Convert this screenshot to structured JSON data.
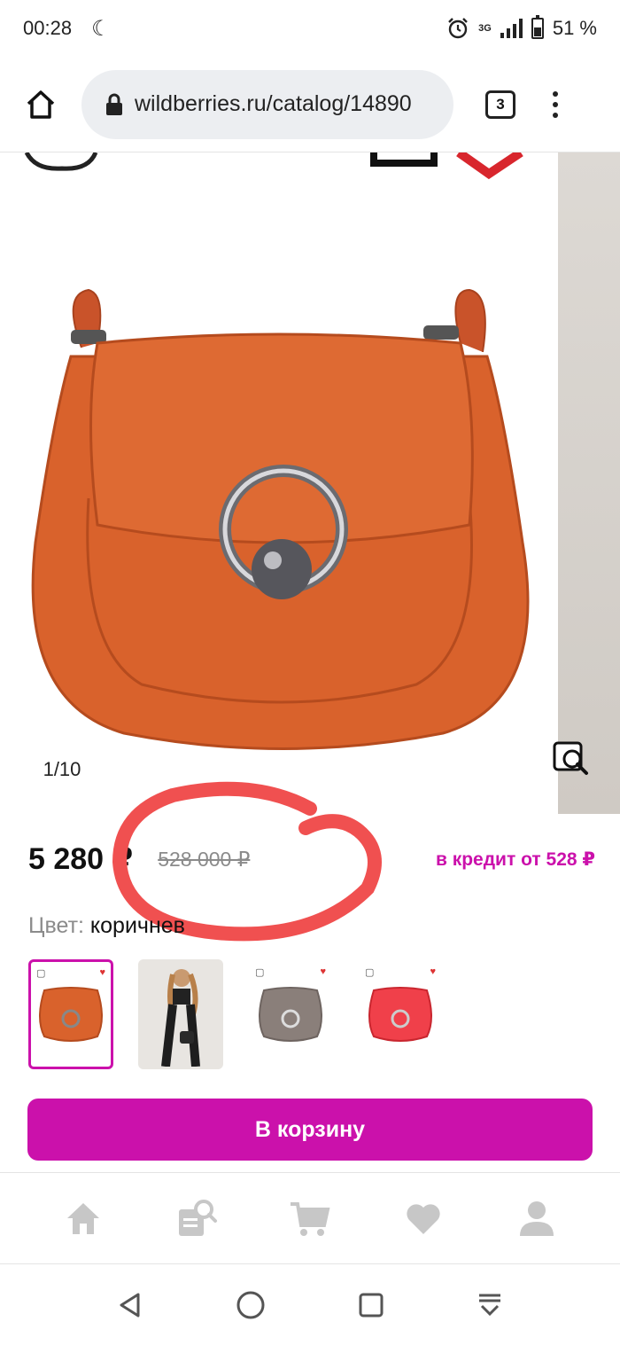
{
  "status_bar": {
    "time": "00:28",
    "network": "3G",
    "battery": "51 %",
    "battery_level": 0.51
  },
  "browser": {
    "url": "wildberries.ru/catalog/14890",
    "tab_count": "3"
  },
  "gallery": {
    "counter": "1/10"
  },
  "product": {
    "price": "5 280 ₽",
    "old_price": "528 000 ₽",
    "credit": "в кредит от 528 ₽",
    "color_label": "Цвет:",
    "color_value": "коричнев",
    "swatch_colors": [
      "#d9622c",
      "#2a2a2a",
      "#8a7f7a",
      "#f0404a"
    ]
  },
  "cart_button": {
    "label": "В корзину"
  },
  "colors": {
    "accent": "#cb11ab",
    "annotation": "#f05050"
  }
}
